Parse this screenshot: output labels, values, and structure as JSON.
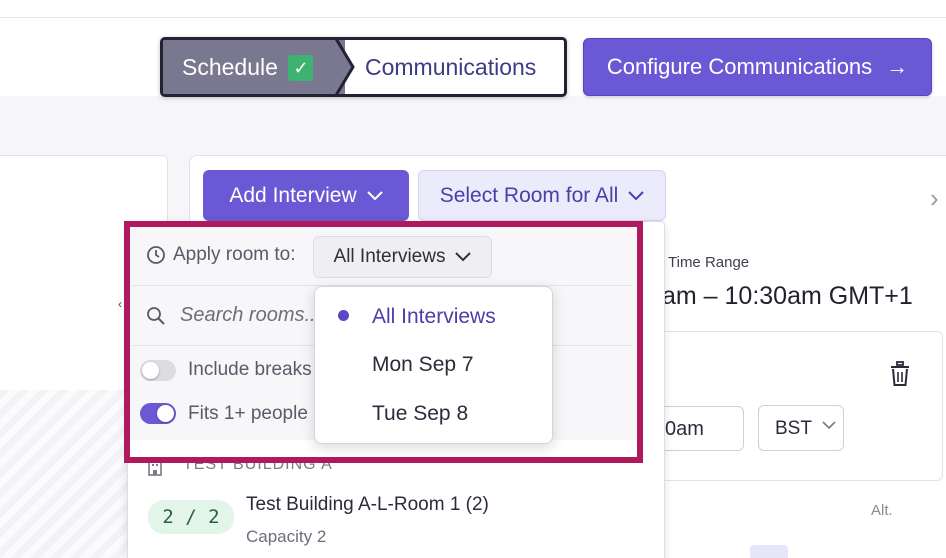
{
  "stepper": {
    "steps": [
      {
        "label": "Schedule",
        "completed": true
      },
      {
        "label": "Communications",
        "completed": false
      }
    ],
    "check_glyph": "✓"
  },
  "config_button": {
    "label": "Configure Communications",
    "arrow": "→"
  },
  "toolbar": {
    "add_interview_label": "Add Interview",
    "select_room_label": "Select Room for All",
    "chevron": "⌄",
    "next_chevron": "›"
  },
  "time_range": {
    "label": "Time Range",
    "value": "am – 10:30am GMT+1"
  },
  "schedule_card": {
    "time_value": "0am",
    "timezone": "BST",
    "alt_label": "Alt."
  },
  "room_panel": {
    "apply_label": "Apply room to:",
    "apply_selected": "All Interviews",
    "search_placeholder": "Search rooms...",
    "toggles": [
      {
        "label": "Include breaks",
        "on": false
      },
      {
        "label": "Fits 1+ people",
        "on": true
      }
    ],
    "building": "TEST BUILDING A",
    "rooms": [
      {
        "capacity_badge": "2 / 2",
        "name": "Test Building A-L-Room 1 (2)",
        "capacity": "Capacity 2"
      }
    ]
  },
  "apply_menu": {
    "options": [
      "All Interviews",
      "Mon Sep 7",
      "Tue Sep 8"
    ],
    "selected_index": 0
  },
  "icons": {
    "clock": "clock-icon",
    "search": "search-icon",
    "trash": "trash-icon",
    "building": "building-icon",
    "check": "check-icon"
  },
  "colors": {
    "accent": "#6a58d4",
    "highlight": "#b1195f",
    "success": "#3eb36f"
  }
}
